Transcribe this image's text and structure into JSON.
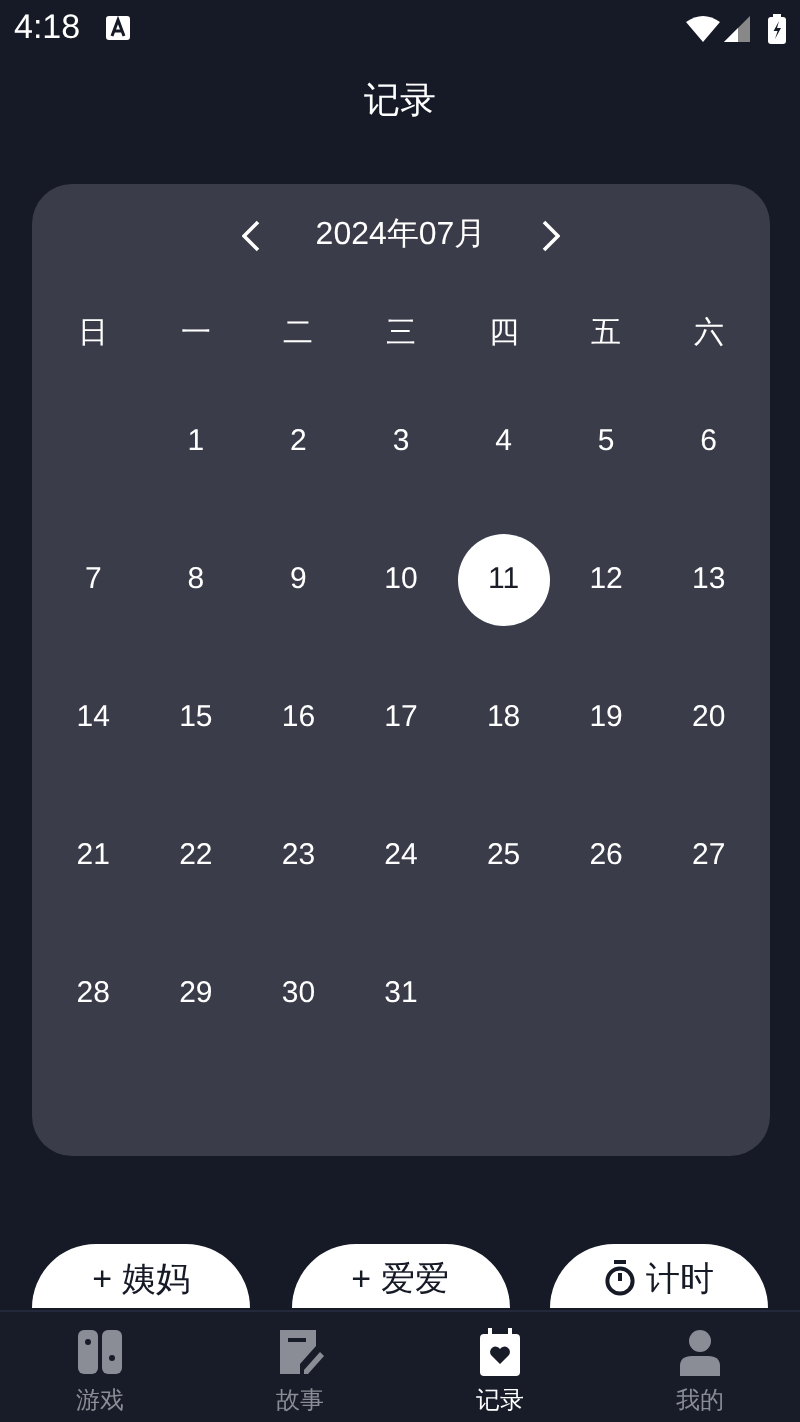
{
  "status_bar": {
    "time": "4:18"
  },
  "title": "记录",
  "calendar": {
    "month": "2024年07月",
    "weekdays": [
      "日",
      "一",
      "二",
      "三",
      "四",
      "五",
      "六"
    ],
    "weeks": [
      [
        {
          "day": "1",
          "selected": false
        },
        {
          "day": "2",
          "selected": false
        },
        {
          "day": "3",
          "selected": false
        },
        {
          "day": "4",
          "selected": false
        },
        {
          "day": "5",
          "selected": false
        },
        {
          "day": "6",
          "selected": false
        }
      ],
      [
        {
          "day": "7",
          "selected": false
        },
        {
          "day": "8",
          "selected": false
        },
        {
          "day": "9",
          "selected": false
        },
        {
          "day": "10",
          "selected": false
        },
        {
          "day": "11",
          "selected": true
        },
        {
          "day": "12",
          "selected": false
        },
        {
          "day": "13",
          "selected": false
        }
      ],
      [
        {
          "day": "14",
          "selected": false
        },
        {
          "day": "15",
          "selected": false
        },
        {
          "day": "16",
          "selected": false
        },
        {
          "day": "17",
          "selected": false
        },
        {
          "day": "18",
          "selected": false
        },
        {
          "day": "19",
          "selected": false
        },
        {
          "day": "20",
          "selected": false
        }
      ],
      [
        {
          "day": "21",
          "selected": false
        },
        {
          "day": "22",
          "selected": false
        },
        {
          "day": "23",
          "selected": false
        },
        {
          "day": "24",
          "selected": false
        },
        {
          "day": "25",
          "selected": false
        },
        {
          "day": "26",
          "selected": false
        },
        {
          "day": "27",
          "selected": false
        }
      ],
      [
        {
          "day": "28",
          "selected": false
        },
        {
          "day": "29",
          "selected": false
        },
        {
          "day": "30",
          "selected": false
        },
        {
          "day": "31",
          "selected": false
        }
      ]
    ]
  },
  "actions": [
    {
      "kind": "add",
      "label": "+ 姨妈"
    },
    {
      "kind": "add",
      "label": "+ 爱爱"
    },
    {
      "kind": "timer",
      "label": "计时"
    }
  ],
  "nav": [
    {
      "kind": "game",
      "label": "游戏",
      "selected": false
    },
    {
      "kind": "story",
      "label": "故事",
      "selected": false
    },
    {
      "kind": "record",
      "label": "记录",
      "selected": true
    },
    {
      "kind": "me",
      "label": "我的",
      "selected": false
    }
  ]
}
